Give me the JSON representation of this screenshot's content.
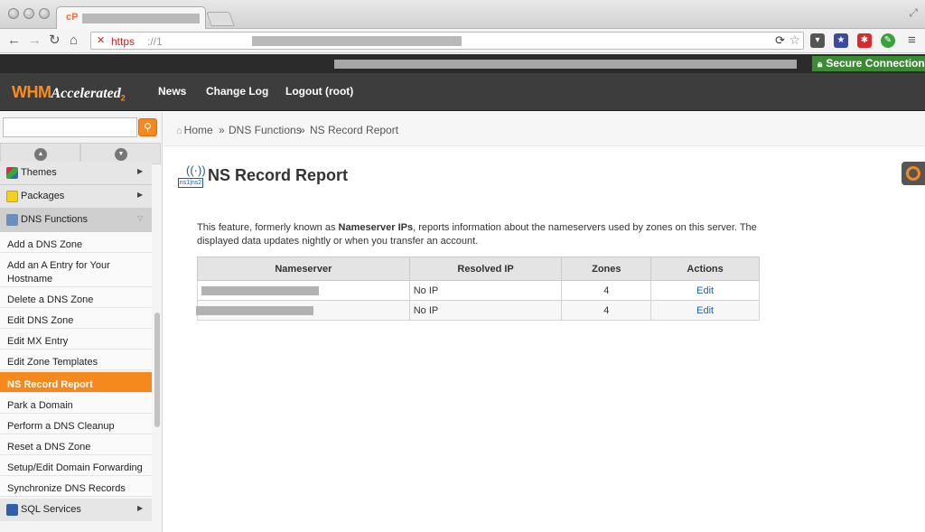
{
  "browser": {
    "tab_favicon": "cP",
    "url_scheme": "https",
    "url_rest": "://1",
    "icons": [
      "back-icon",
      "forward-icon",
      "reload-icon",
      "home-icon",
      "star-icon",
      "pocket-icon",
      "menu-icon"
    ]
  },
  "header": {
    "secure_label": "Secure Connection",
    "logo_whm": "WHM",
    "logo_accelerated": "Accelerated",
    "logo_version": "2",
    "nav": [
      "News",
      "Change Log",
      "Logout (root)"
    ]
  },
  "sidebar": {
    "search_placeholder": "",
    "categories": {
      "themes": "Themes",
      "packages": "Packages",
      "dns": "DNS Functions",
      "sql": "SQL Services"
    },
    "items": [
      "Add a DNS Zone",
      "Add an A Entry for Your Hostname",
      "Delete a DNS Zone",
      "Edit DNS Zone",
      "Edit MX Entry",
      "Edit Zone Templates",
      "NS Record Report",
      "Park a Domain",
      "Perform a DNS Cleanup",
      "Reset a DNS Zone",
      "Setup/Edit Domain Forwarding",
      "Synchronize DNS Records"
    ]
  },
  "breadcrumb": {
    "home": "Home",
    "sep": "»",
    "section": "DNS Functions",
    "current": "NS Record Report"
  },
  "page": {
    "icon_label": "ns1|ns2",
    "title": "NS Record Report",
    "desc_before": "This feature, formerly known as ",
    "desc_bold": "Nameserver IPs",
    "desc_after": ", reports information about the nameservers used by zones on this server. The displayed data updates nightly or when you transfer an account."
  },
  "table": {
    "headers": [
      "Nameserver",
      "Resolved IP",
      "Zones",
      "Actions"
    ],
    "rows": [
      {
        "resolved_ip": "No IP",
        "zones": "4",
        "action": "Edit"
      },
      {
        "resolved_ip": "No IP",
        "zones": "4",
        "action": "Edit"
      }
    ]
  }
}
